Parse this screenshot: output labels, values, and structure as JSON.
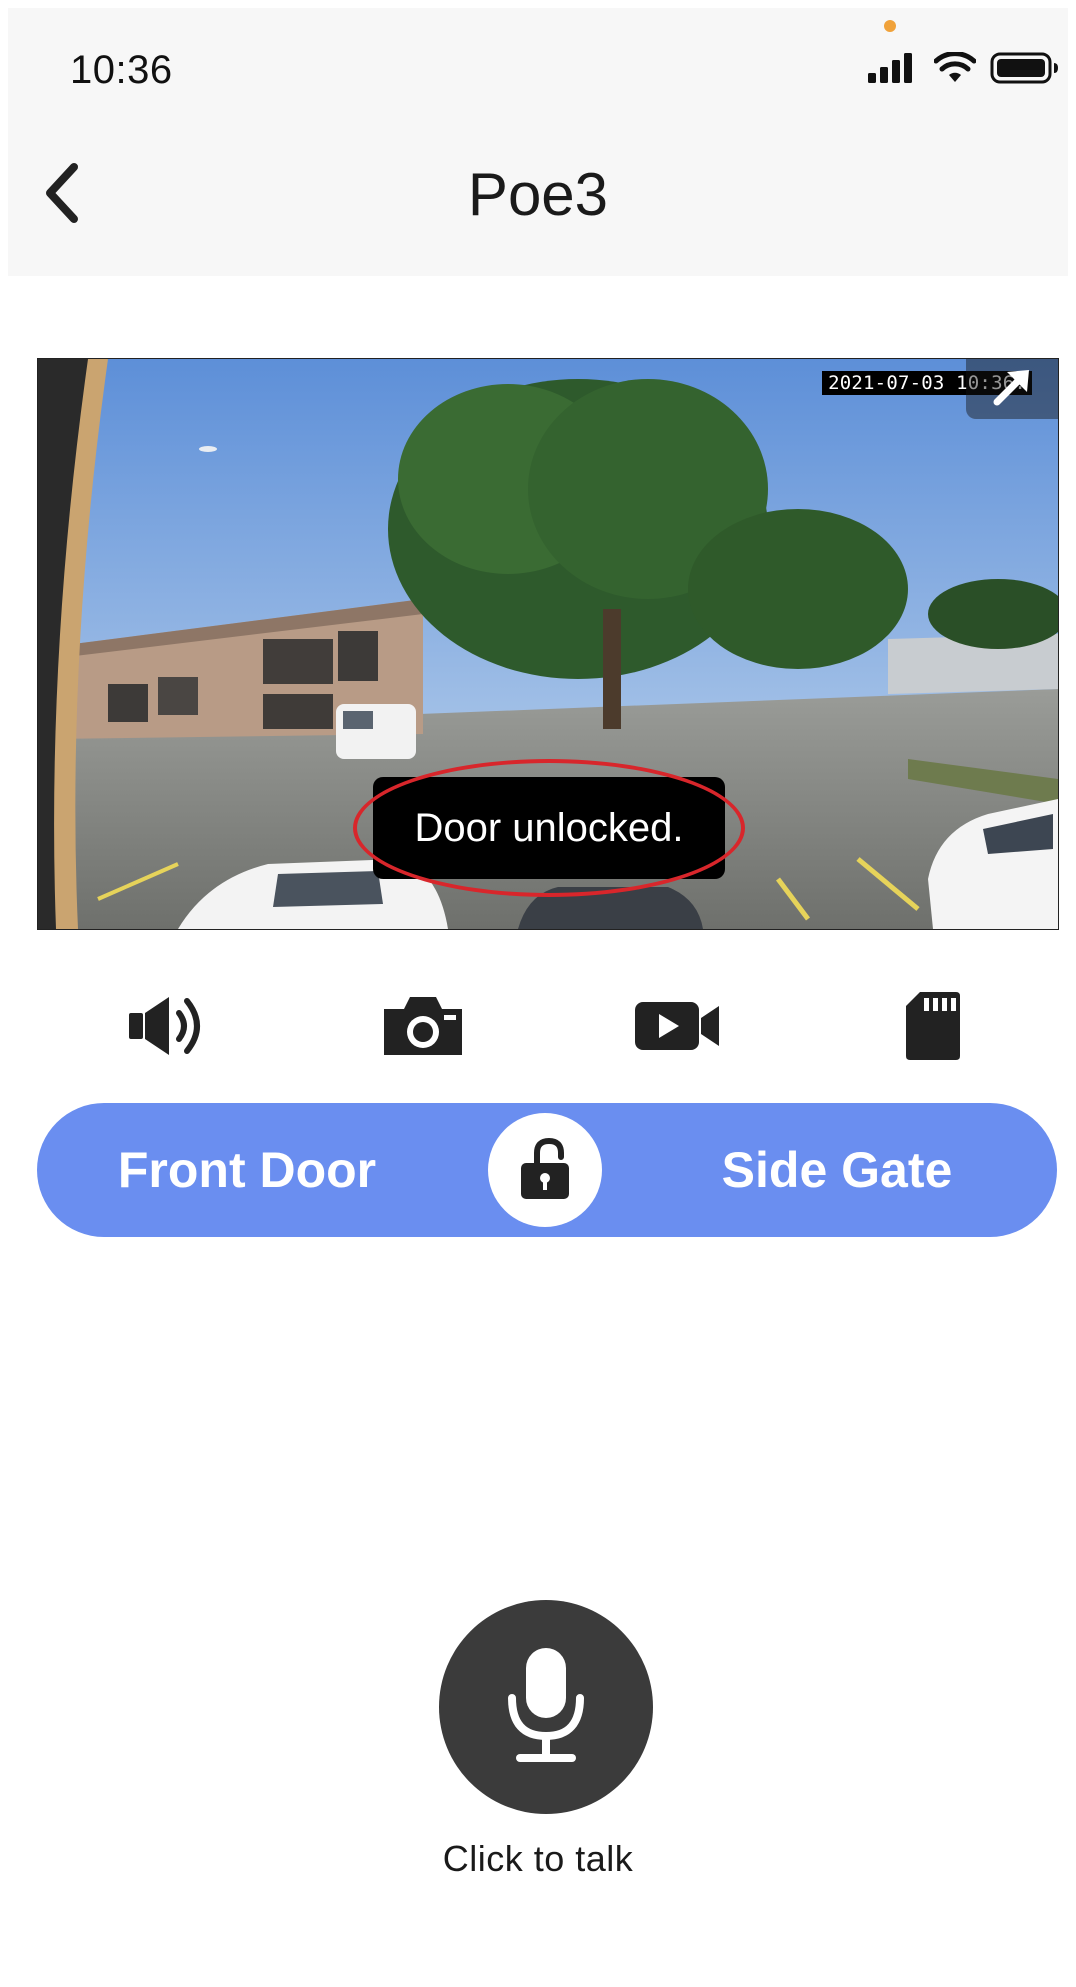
{
  "status_bar": {
    "time": "10:36",
    "icons": [
      "cellular-signal-icon",
      "wifi-icon",
      "battery-icon"
    ]
  },
  "header": {
    "title": "Poe3",
    "back_icon": "chevron-left-icon"
  },
  "video": {
    "timestamp": "2021-07-03 10:36:",
    "toast": "Door unlocked.",
    "fullscreen_icon": "expand-arrow-icon"
  },
  "controls": [
    {
      "name": "speaker-icon"
    },
    {
      "name": "camera-icon"
    },
    {
      "name": "video-record-icon"
    },
    {
      "name": "sd-card-icon"
    }
  ],
  "lock_bar": {
    "left_label": "Front Door",
    "right_label": "Side Gate",
    "lock_icon": "unlock-icon",
    "color": "#6a8ef0"
  },
  "talk": {
    "label": "Click to talk",
    "icon": "microphone-icon"
  }
}
